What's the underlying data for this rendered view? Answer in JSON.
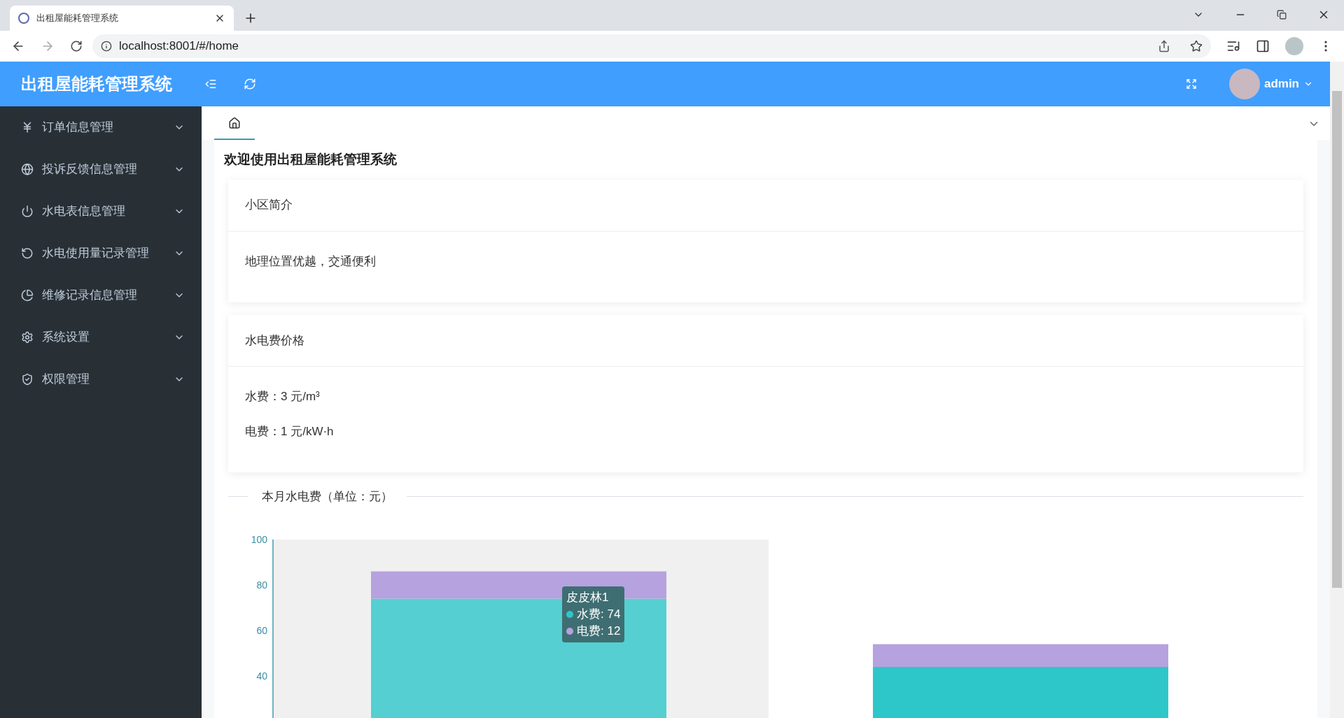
{
  "browser": {
    "tab_title": "出租屋能耗管理系统",
    "url": "localhost:8001/#/home"
  },
  "header": {
    "title": "出租屋能耗管理系统",
    "user": "admin"
  },
  "sidebar": {
    "items": [
      {
        "label": "订单信息管理",
        "expanded": false
      },
      {
        "label": "投诉反馈信息管理",
        "expanded": false
      },
      {
        "label": "水电表信息管理",
        "expanded": false
      },
      {
        "label": "水电使用量记录管理",
        "expanded": false
      },
      {
        "label": "维修记录信息管理",
        "expanded": false
      },
      {
        "label": "系统设置",
        "expanded": false
      },
      {
        "label": "权限管理",
        "expanded": false
      }
    ]
  },
  "tabs": [
    {
      "selected": true
    }
  ],
  "page_title": "欢迎使用出租屋能耗管理系统",
  "cards": [
    {
      "title": "小区简介",
      "lines": [
        "地理位置优越，交通便利"
      ]
    },
    {
      "title": "水电费价格",
      "lines": [
        "水费：3 元/m³",
        "电费：1 元/kW·h"
      ]
    }
  ],
  "chart_section": {
    "title": "本月水电费（单位：元）",
    "chart_data": {
      "type": "bar",
      "stacked": true,
      "ylim": [
        0,
        100
      ],
      "yticks": [
        40,
        60,
        80,
        100
      ],
      "series": [
        {
          "color": "#2ec7c9",
          "values": [
            74,
            44
          ]
        },
        {
          "color": "#b6a2de",
          "values": [
            12,
            10
          ]
        }
      ]
    },
    "tooltip": {
      "title": "皮皮林1",
      "entries": [
        {
          "label": "水费: 74",
          "color": "#2ec7c9"
        },
        {
          "label": "电费: 12",
          "color": "#b6a2de"
        }
      ]
    }
  }
}
